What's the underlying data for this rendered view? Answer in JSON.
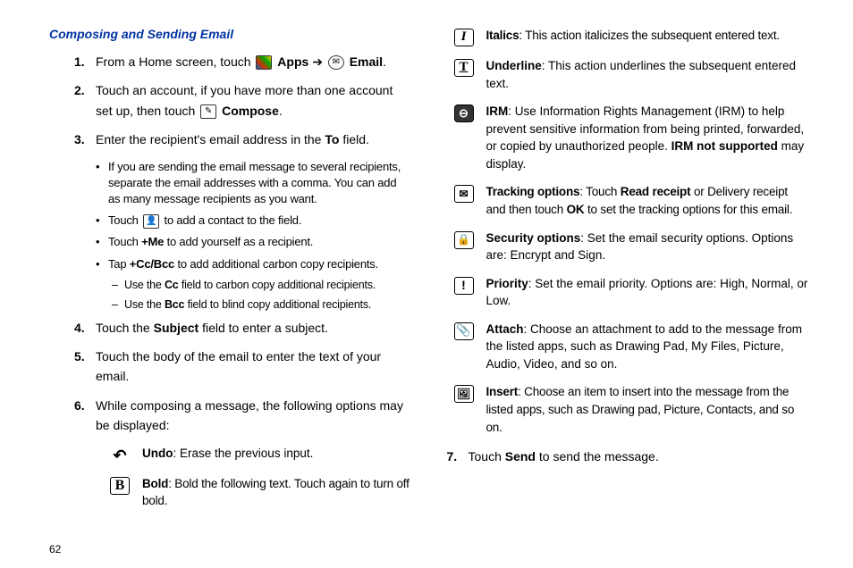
{
  "page_number": "62",
  "heading": "Composing and Sending Email",
  "steps": {
    "s1": {
      "num": "1.",
      "pre": "From a Home screen, touch ",
      "apps": "Apps",
      "arrow": "➔",
      "email": "Email",
      "post": "."
    },
    "s2": {
      "num": "2.",
      "pre": "Touch an account, if you have more than one account set up, then touch ",
      "compose": "Compose",
      "post": "."
    },
    "s3": {
      "num": "3.",
      "pre": "Enter the recipient's email address in the ",
      "to": "To",
      "post": " field."
    },
    "s4": {
      "num": "4.",
      "pre": "Touch the ",
      "subject": "Subject",
      "post": " field to enter a subject."
    },
    "s5": {
      "num": "5.",
      "text": "Touch the body of the email to enter the text of your email."
    },
    "s6": {
      "num": "6.",
      "text": "While composing a message, the following options may be displayed:"
    },
    "s7": {
      "num": "7.",
      "pre": "Touch ",
      "send": "Send",
      "post": " to send the message."
    }
  },
  "bullets": {
    "b1": "If you are sending the email message to several recipients, separate the email addresses with a comma. You can add as many message recipients as you want.",
    "b2_pre": "Touch ",
    "b2_post": " to add a contact to the field.",
    "b3_pre": "Touch ",
    "b3_me": "+Me",
    "b3_post": " to add yourself as a recipient.",
    "b4_pre": "Tap ",
    "b4_cc": "+Cc/Bcc",
    "b4_post": " to add additional carbon copy recipients."
  },
  "dashes": {
    "d1_pre": "Use the ",
    "d1_cc": "Cc",
    "d1_post": " field to carbon copy additional recipients.",
    "d2_pre": "Use the ",
    "d2_bcc": "Bcc",
    "d2_post": " field to blind copy additional recipients."
  },
  "opts": {
    "undo": {
      "label": "Undo",
      "text": ": Erase the previous input."
    },
    "bold": {
      "label": "Bold",
      "text": ": Bold the following text. Touch again to turn off bold."
    },
    "italics": {
      "label": "Italics",
      "text": ": This action italicizes the subsequent entered text."
    },
    "underline": {
      "label": "Underline",
      "text": ": This action underlines the subsequent entered text."
    },
    "irm": {
      "label": "IRM",
      "text": ": Use Information Rights Management (IRM) to help prevent sensitive information from being printed, forwarded, or copied by unauthorized people. ",
      "extra": "IRM not supported",
      "extra2": " may display."
    },
    "tracking": {
      "label": "Tracking options",
      "pre": ": Touch ",
      "rr": "Read receipt",
      "mid": " or Delivery receipt and then touch ",
      "ok": "OK",
      "post": " to set the tracking options for this email."
    },
    "security": {
      "label": "Security options",
      "text": ": Set the email security options. Options are: Encrypt and Sign."
    },
    "priority": {
      "label": "Priority",
      "text": ": Set the email priority. Options are: High, Normal, or Low."
    },
    "attach": {
      "label": "Attach",
      "text": ": Choose an attachment to add to the message from the listed apps, such as Drawing Pad, My Files, Picture, Audio, Video, and so on."
    },
    "insert": {
      "label": "Insert",
      "text": ": Choose an item to insert into the message from the listed apps, such as Drawing pad, Picture, Contacts, and so on."
    }
  }
}
